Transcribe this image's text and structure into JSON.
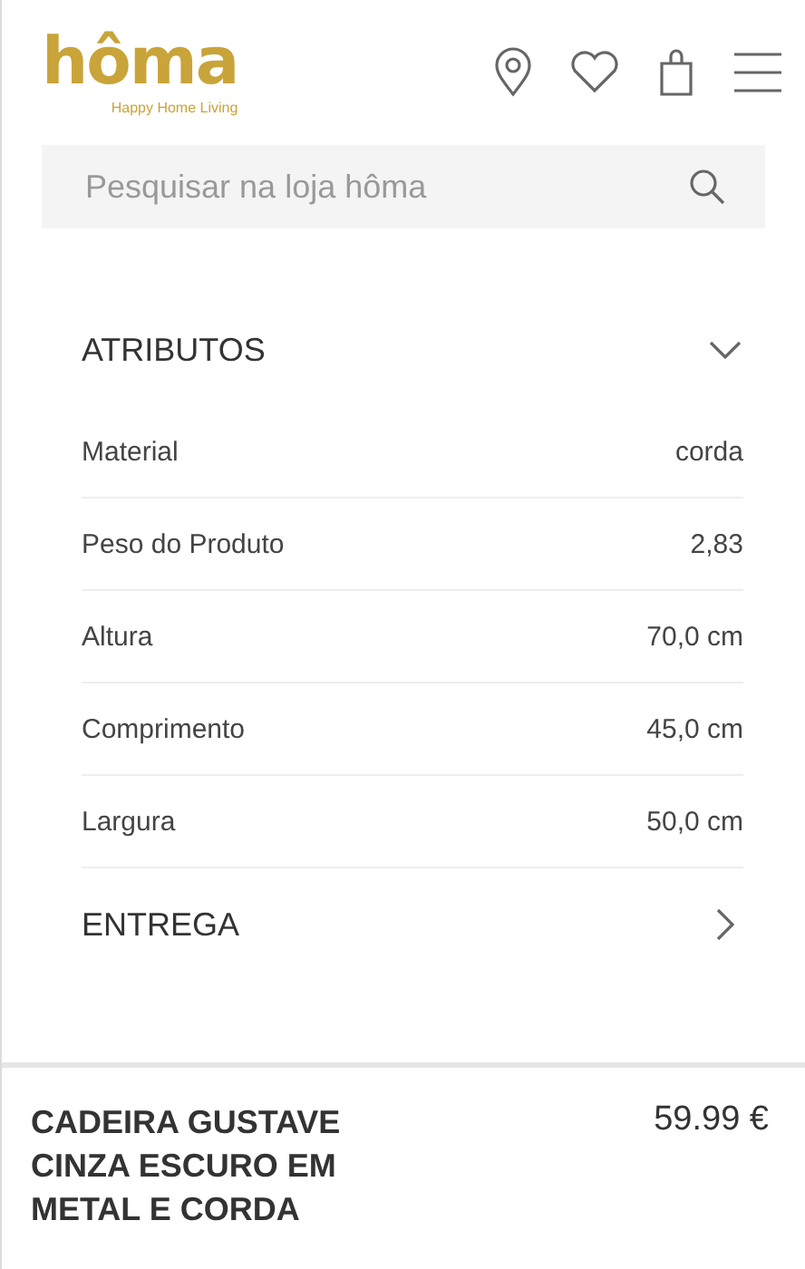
{
  "header": {
    "logo": "hôma",
    "tagline": "Happy Home Living"
  },
  "search": {
    "placeholder": "Pesquisar na loja hôma"
  },
  "sections": [
    {
      "title": "ATRIBUTOS",
      "expanded": true,
      "rows": [
        {
          "label": "Material",
          "value": "corda"
        },
        {
          "label": "Peso do Produto",
          "value": "2,83"
        },
        {
          "label": "Altura",
          "value": "70,0 cm"
        },
        {
          "label": "Comprimento",
          "value": "45,0 cm"
        },
        {
          "label": "Largura",
          "value": "50,0 cm"
        }
      ]
    },
    {
      "title": "ENTREGA",
      "expanded": false
    }
  ],
  "product": {
    "name": "CADEIRA GUSTAVE CINZA ESCURO EM METAL E CORDA",
    "price": "59.99 €"
  }
}
